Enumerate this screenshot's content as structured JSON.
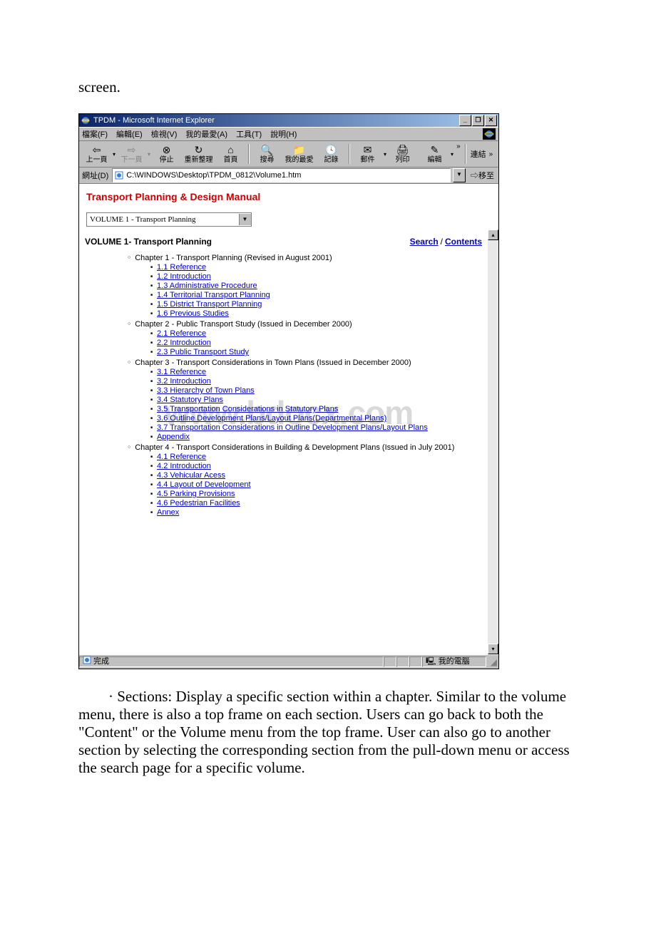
{
  "pre_text": "screen.",
  "window": {
    "title": "TPDM - Microsoft Internet Explorer",
    "min_label": "_",
    "max_label": "❐",
    "close_label": "✕"
  },
  "menubar": {
    "file": "檔案(F)",
    "edit": "編輯(E)",
    "view": "檢視(V)",
    "favorites": "我的最愛(A)",
    "tools": "工具(T)",
    "help": "說明(H)"
  },
  "toolbar": {
    "back": "上一頁",
    "forward": "下一頁",
    "stop": "停止",
    "refresh": "重新整理",
    "home": "首頁",
    "search": "搜尋",
    "favorites": "我的最愛",
    "history": "記錄",
    "mail": "郵件",
    "print": "列印",
    "edit": "編輯",
    "links": "連結"
  },
  "address": {
    "label": "網址(D)",
    "value": "C:\\WINDOWS\\Desktop\\TPDM_0812\\Volume1.htm",
    "go": "移至"
  },
  "frame": {
    "manual_title": "Transport Planning & Design Manual",
    "volume_select": "VOLUME 1 - Transport Planning"
  },
  "content": {
    "heading": "VOLUME 1- Transport Planning",
    "search_label": "Search",
    "contents_label": "Contents",
    "chapters": [
      {
        "title": "Chapter 1 - Transport Planning (Revised in August 2001)",
        "items": [
          "1.1 Reference",
          "1.2 Introduction",
          "1.3 Administrative Procedure",
          "1.4 Territorial Transport Planning",
          "1.5 District Transport Planning",
          "1.6 Previous Studies"
        ]
      },
      {
        "title": "Chapter 2 - Public Transport Study (Issued in December 2000)",
        "items": [
          "2.1 Reference",
          "2.2 Introduction",
          "2.3 Public Transport Study"
        ]
      },
      {
        "title": "Chapter 3 - Transport Considerations in Town Plans (Issued in December 2000)",
        "items": [
          "3.1 Reference",
          "3.2 Introduction",
          "3.3 Hierarchy of Town Plans",
          "3.4 Statutory Plans",
          "3.5 Transportation Considerations in Statutory Plans",
          "3.6 Outline Development Plans/Layout Plans(Departmental Plans)",
          "3.7 Transportation Considerations in Outline Development Plans/Layout Plans",
          "Appendix"
        ]
      },
      {
        "title": "Chapter 4 - Transport Considerations in Building & Development Plans (Issued in July 2001)",
        "items": [
          "4.1 Reference",
          "4.2 Introduction",
          "4.3 Vehicular Acess",
          "4.4 Layout of Development",
          "4.5 Parking Provisions",
          "4.6 Pedestrian Facilities",
          "Annex"
        ]
      }
    ]
  },
  "watermark": "www.bdocx.com",
  "status": {
    "done": "完成",
    "zone": "我的電腦"
  },
  "post_text": "· Sections: Display a specific section within a chapter. Similar to the volume menu, there is also a top frame on each section. Users can go back to both the \"Content\" or the Volume menu from the top frame. User can also go to another section by selecting the corresponding section from the pull-down menu or access the search page for a specific volume."
}
